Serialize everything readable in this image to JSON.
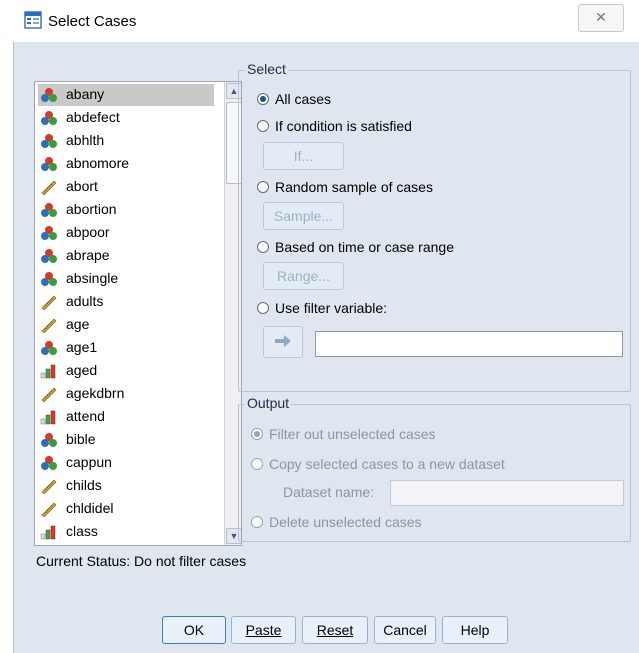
{
  "window": {
    "title": "Select Cases",
    "close_glyph": "✕",
    "icon": "select-cases-icon"
  },
  "variables": [
    {
      "name": "abany",
      "type": "nominal",
      "selected": true
    },
    {
      "name": "abdefect",
      "type": "nominal"
    },
    {
      "name": "abhlth",
      "type": "nominal"
    },
    {
      "name": "abnomore",
      "type": "nominal"
    },
    {
      "name": "abort",
      "type": "scale"
    },
    {
      "name": "abortion",
      "type": "nominal"
    },
    {
      "name": "abpoor",
      "type": "nominal"
    },
    {
      "name": "abrape",
      "type": "nominal"
    },
    {
      "name": "absingle",
      "type": "nominal"
    },
    {
      "name": "adults",
      "type": "scale"
    },
    {
      "name": "age",
      "type": "scale"
    },
    {
      "name": "age1",
      "type": "nominal"
    },
    {
      "name": "aged",
      "type": "ordinal"
    },
    {
      "name": "agekdbrn",
      "type": "scale"
    },
    {
      "name": "attend",
      "type": "ordinal"
    },
    {
      "name": "bible",
      "type": "nominal"
    },
    {
      "name": "cappun",
      "type": "nominal"
    },
    {
      "name": "childs",
      "type": "scale"
    },
    {
      "name": "chldidel",
      "type": "scale"
    },
    {
      "name": "class",
      "type": "ordinal"
    }
  ],
  "select": {
    "group_label": "Select",
    "all_cases": "All cases",
    "if_condition": "If condition is satisfied",
    "if_button": "If...",
    "random_sample": "Random sample of cases",
    "sample_button": "Sample...",
    "based_on_time": "Based on time or case range",
    "range_button": "Range...",
    "use_filter": "Use filter variable:",
    "selected_option": "all_cases"
  },
  "output": {
    "group_label": "Output",
    "filter_out": "Filter out unselected cases",
    "copy_selected": "Copy selected cases to a new dataset",
    "dataset_name_label": "Dataset name:",
    "dataset_name_value": "",
    "delete_unselected": "Delete unselected cases",
    "selected_option": "filter_out"
  },
  "status": {
    "text": "Current Status: Do not filter cases"
  },
  "buttons": {
    "ok": "OK",
    "paste": "Paste",
    "reset": "Reset",
    "cancel": "Cancel",
    "help": "Help"
  },
  "colors": {
    "accent": "#1f4f97",
    "nominal": "#d23a2a",
    "scale": "#c9a23a",
    "ordinal": "#3b7a3b"
  }
}
